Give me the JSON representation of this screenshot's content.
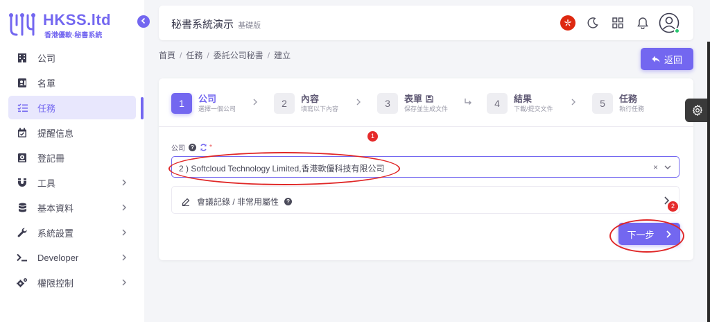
{
  "logo": {
    "title": "HKSS.ltd",
    "subtitle": "香港優軟·秘書系統"
  },
  "sidebar": {
    "items": [
      {
        "label": "公司",
        "icon": "building-icon",
        "expandable": false,
        "active": false
      },
      {
        "label": "名單",
        "icon": "contact-card-icon",
        "expandable": false,
        "active": false
      },
      {
        "label": "任務",
        "icon": "checklist-icon",
        "expandable": false,
        "active": true
      },
      {
        "label": "提醒信息",
        "icon": "calendar-icon",
        "expandable": false,
        "active": false
      },
      {
        "label": "登記冊",
        "icon": "register-icon",
        "expandable": false,
        "active": false
      },
      {
        "label": "工具",
        "icon": "magnet-icon",
        "expandable": true,
        "active": false
      },
      {
        "label": "基本資料",
        "icon": "database-icon",
        "expandable": true,
        "active": false
      },
      {
        "label": "系統設置",
        "icon": "wrench-icon",
        "expandable": true,
        "active": false
      },
      {
        "label": "Developer",
        "icon": "terminal-icon",
        "expandable": true,
        "active": false
      },
      {
        "label": "權限控制",
        "icon": "cogs-icon",
        "expandable": true,
        "active": false
      }
    ]
  },
  "header": {
    "title": "秘書系統演示",
    "subtitle": "基礎版"
  },
  "breadcrumb": [
    "首頁",
    "任務",
    "委託公司秘書",
    "建立"
  ],
  "back_label": "返回",
  "steps": [
    {
      "num": "1",
      "title": "公司",
      "sub": "選擇一個公司",
      "active": true
    },
    {
      "num": "2",
      "title": "內容",
      "sub": "填寫以下內容",
      "active": false
    },
    {
      "num": "3",
      "title": "表單",
      "sub": "保存並生成文件",
      "active": false
    },
    {
      "num": "4",
      "title": "結果",
      "sub": "下載/提交文件",
      "active": false
    },
    {
      "num": "5",
      "title": "任務",
      "sub": "執行任務",
      "active": false
    }
  ],
  "company_field": {
    "label": "公司",
    "required_mark": "*",
    "value": "2 ) Softcloud Technology Limited,香港軟優科技有限公司",
    "clear": "×"
  },
  "collapse_section": {
    "title": "會議記錄 / 非常用屬性"
  },
  "next_label": "下一步",
  "annotations": [
    "1",
    "2"
  ],
  "colors": {
    "primary": "#7367f0",
    "annotation": "#e52b2b",
    "flag": "#de2910"
  }
}
